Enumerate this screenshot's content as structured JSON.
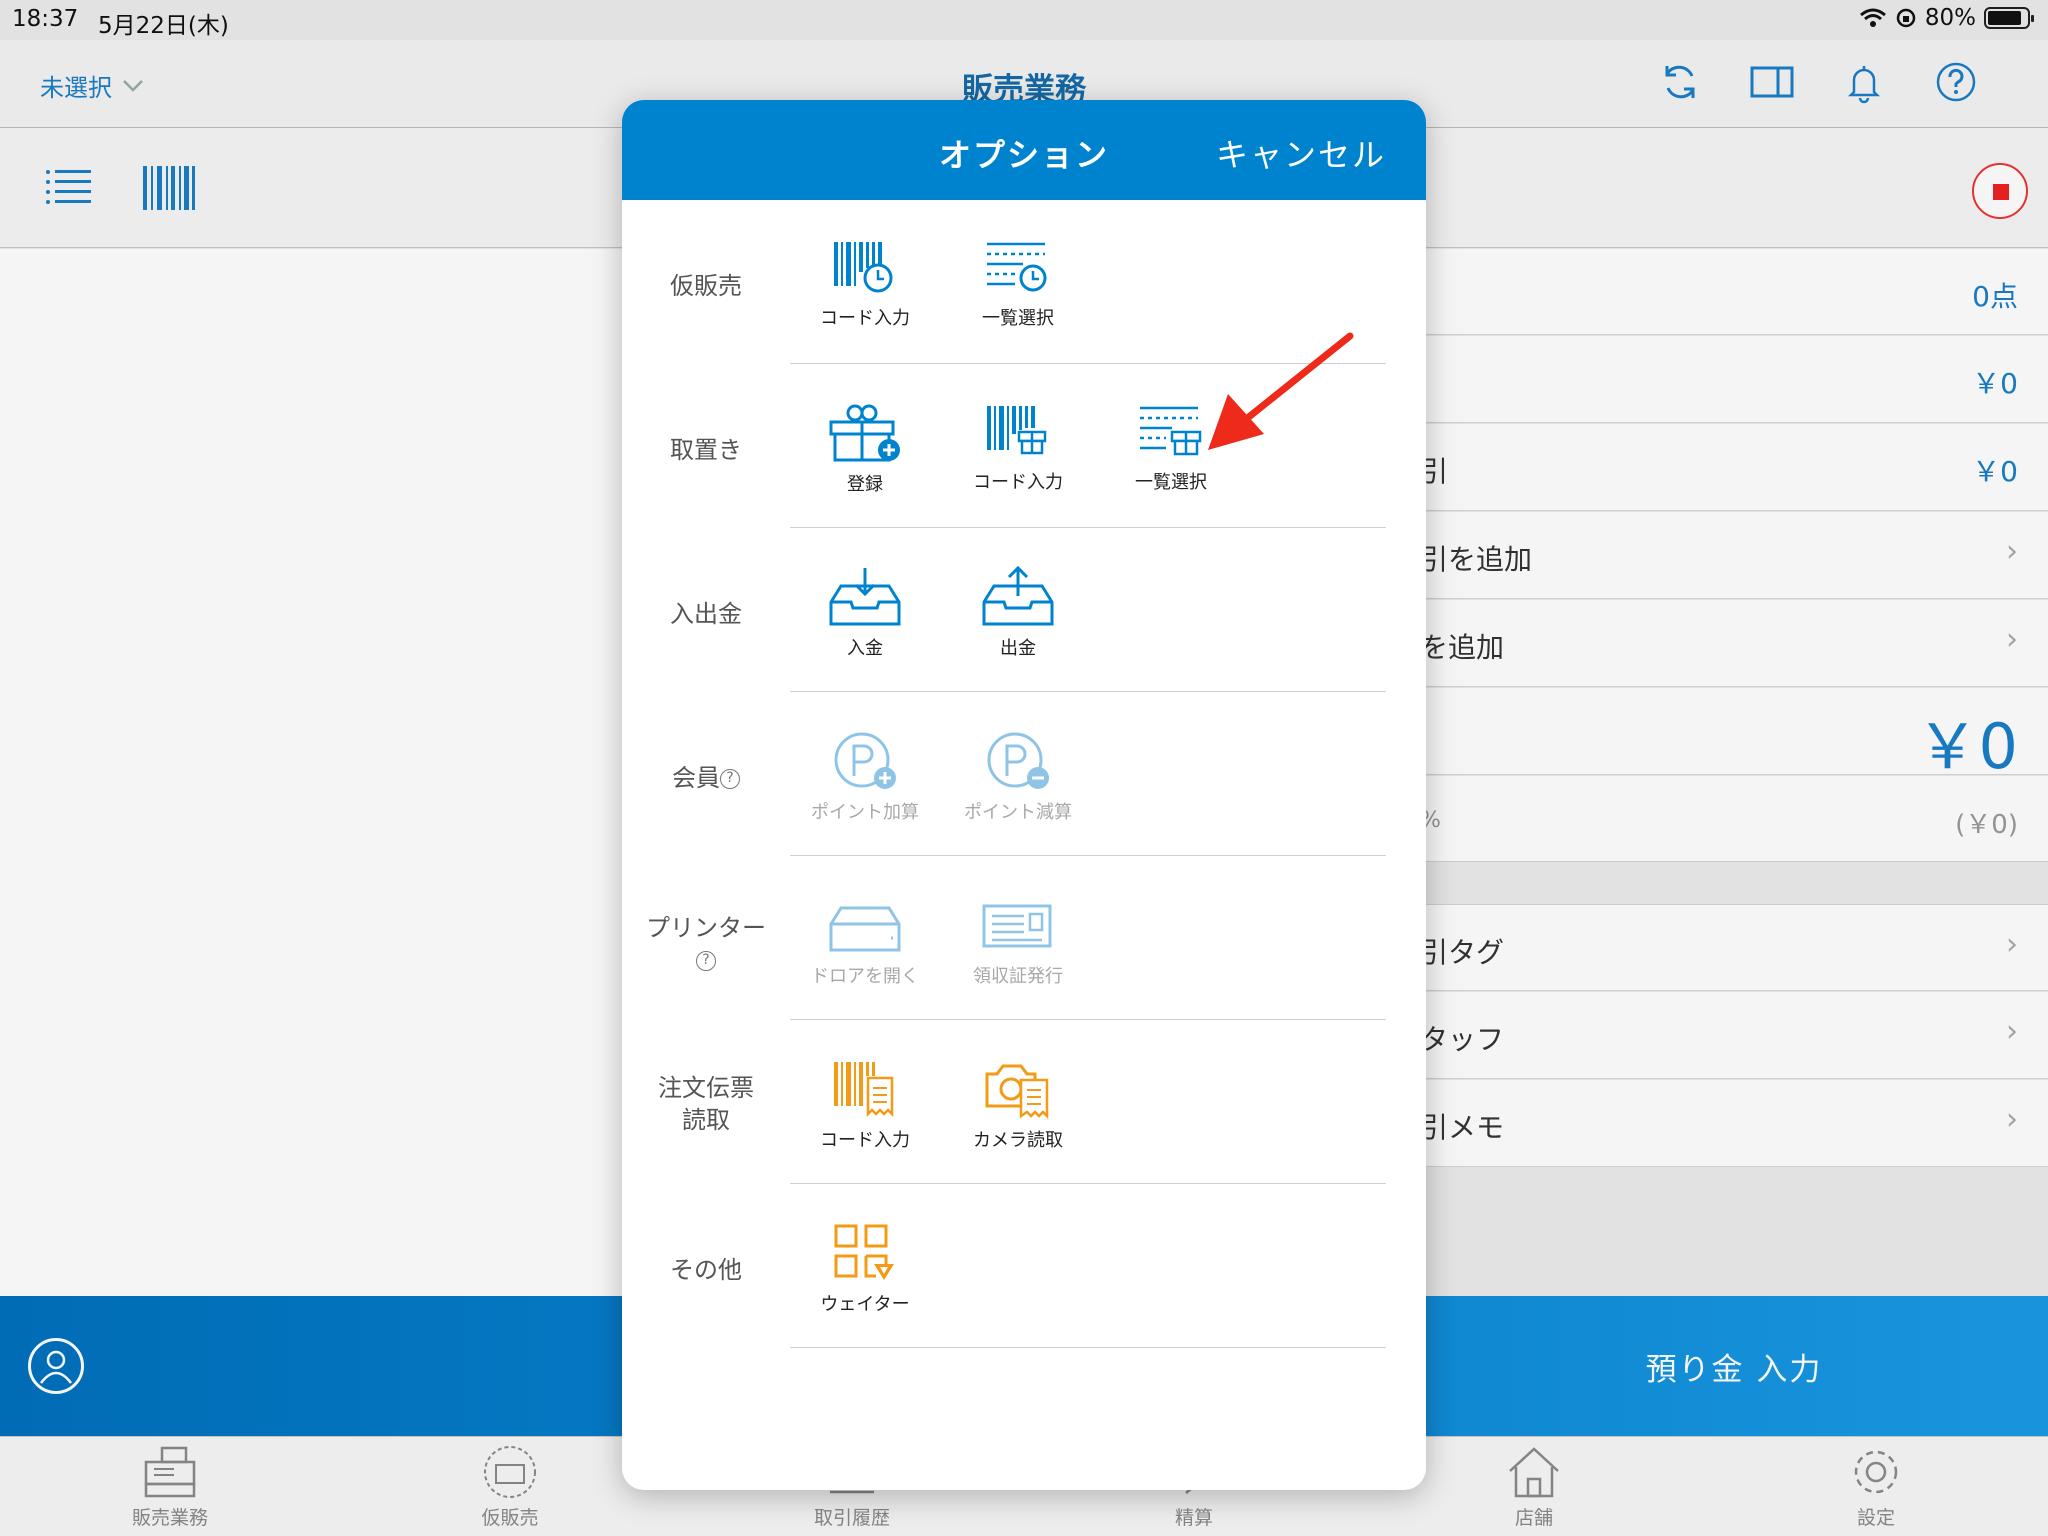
{
  "status_bar": {
    "time": "18:37",
    "date": "5月22日(木)",
    "battery": "80%"
  },
  "nav": {
    "unselected": "未選択",
    "title": "販売業務"
  },
  "summary_rows": [
    {
      "label": "",
      "value": "0点"
    },
    {
      "label": "",
      "value": "￥0"
    },
    {
      "label": "引",
      "value": "￥0"
    },
    {
      "label": "引を追加",
      "value": ""
    },
    {
      "label": "を追加",
      "value": ""
    },
    {
      "label": "",
      "value": "￥0"
    },
    {
      "label": "%",
      "value": "(￥0)"
    },
    {
      "label": "引タグ",
      "value": ""
    },
    {
      "label": "タッフ",
      "value": ""
    },
    {
      "label": "引メモ",
      "value": ""
    }
  ],
  "action_bar": {
    "deposit": "預り金 入力"
  },
  "tabs": [
    "販売業務",
    "仮販売",
    "取引履歴",
    "精算",
    "店舗",
    "設定"
  ],
  "modal": {
    "title": "オプション",
    "cancel": "キャンセル",
    "sections": [
      {
        "label": "仮販売",
        "options": [
          "コード入力",
          "一覧選択"
        ]
      },
      {
        "label": "取置き",
        "options": [
          "登録",
          "コード入力",
          "一覧選択"
        ]
      },
      {
        "label": "入出金",
        "options": [
          "入金",
          "出金"
        ]
      },
      {
        "label": "会員",
        "options": [
          "ポイント加算",
          "ポイント減算"
        ]
      },
      {
        "label": "プリンター",
        "options": [
          "ドロアを開く",
          "領収証発行"
        ]
      },
      {
        "label": "注文伝票\n読取",
        "options": [
          "コード入力",
          "カメラ読取"
        ]
      },
      {
        "label": "その他",
        "options": [
          "ウェイター"
        ]
      }
    ]
  },
  "colors": {
    "blue": "#0083cf",
    "orange": "#f39a16",
    "disabled": "#8fc4e6",
    "arrow": "#ee2a1a"
  }
}
